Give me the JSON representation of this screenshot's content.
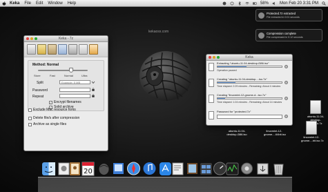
{
  "menubar": {
    "app_name": "Keka",
    "items": [
      "File",
      "Edit",
      "Window",
      "Help"
    ],
    "battery": "58%",
    "clock": "Mon Feb 20  3:31 PM"
  },
  "watermark": "kekaosx.com",
  "prefs_window": {
    "title": "Keka - 7z",
    "method_label": "Method: Normal",
    "ticks": [
      "Store",
      "Fast",
      "Normal",
      "Ultra"
    ],
    "split_label": "Split",
    "split_placeholder": "Example: 5 MB",
    "password_label": "Password",
    "repeat_label": "Repeat",
    "encrypt_filenames": "Encrypt filenames",
    "solid_archive": "Solid archive",
    "exclude_forks": "Exclude Mac resource forks",
    "delete_after": "Delete file/s after compression",
    "archive_single": "Archive as single files",
    "encrypt_checked": true,
    "solid_checked": true,
    "compression_level": 0.67
  },
  "progress_window": {
    "title": "Keka",
    "operations": [
      {
        "title": "Extracting \"ubuntu-11.04-desktop-i386.iso\"",
        "status": "Operation paused",
        "progress": 0.45
      },
      {
        "title": "Creating \"ubuntu-11.04-desktop-...iso.7z\"",
        "status": "Time elapsed: 2:29 minutes - Remaining: About 4 minutes",
        "progress": 0.28
      },
      {
        "title": "Creating \"linuxmint-12-gnome-d...iso.7z\"",
        "status": "Time elapsed: 1:24 minutes - Remaining: About 14 minutes",
        "progress": 0.12
      },
      {
        "title": "Password for \"protected.7z\"",
        "status": "",
        "progress": null
      }
    ]
  },
  "notifications": [
    {
      "title": "Protected.7z extracted",
      "text": "File extracted in 0:01 seconds"
    },
    {
      "title": "Compression complete",
      "text": "File compressed in 0:12 seconds"
    }
  ],
  "desktop_files": [
    {
      "name": "ubuntu-11.04-desktop-i386.iso.7z"
    },
    {
      "name": "ubuntu-11.04-desktop-i386.iso"
    },
    {
      "name": "linuxmint-12-gnome-...64bit.iso"
    },
    {
      "name": "linuxmint-12-gnome-...bit.iso.7z"
    }
  ],
  "dock": {
    "calendar_day": "20",
    "icons": [
      "finder-icon",
      "mail-stamp-icon",
      "address-book-icon",
      "calendar-icon",
      "keka-icon",
      "preview-icon",
      "safari-icon",
      "itunes-icon",
      "app-store-icon",
      "script-editor-icon",
      "photos-icon",
      "mission-control-icon",
      "dashboard-icon",
      "activity-monitor-icon",
      "system-preferences-icon",
      "downloads-stack-icon",
      "trash-icon"
    ]
  }
}
